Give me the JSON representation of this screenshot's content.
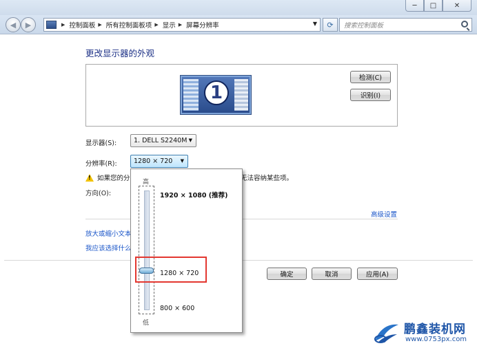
{
  "window": {
    "minimize_glyph": "─",
    "maximize_glyph": "□",
    "close_glyph": "✕"
  },
  "navigation": {
    "breadcrumbs": [
      "控制面板",
      "所有控制面板项",
      "显示",
      "屏幕分辨率"
    ],
    "search_placeholder": "搜索控制面板"
  },
  "main": {
    "title": "更改显示器的外观",
    "monitor_number": "1",
    "detect_button": "检测(C)",
    "identify_button": "识别(I)",
    "display_label": "显示器(S):",
    "display_value": "1. DELL S2240M",
    "resolution_label": "分辨率(R):",
    "resolution_value": "1280 × 720",
    "warning_text_start": "如果您的分",
    "warning_text_end": "无法容纳某些项。",
    "orientation_label": "方向(O):",
    "advanced_link": "高级设置",
    "link_text_size": "放大或缩小文本",
    "link_choose": "我应该选择什么"
  },
  "footer": {
    "ok_button": "确定",
    "cancel_button": "取消",
    "apply_button": "应用(A)"
  },
  "resolution_dropdown": {
    "high_label": "高",
    "low_label": "低",
    "options": [
      "1920 × 1080 (推荐)",
      "1280 × 720",
      "800 × 600"
    ],
    "selected_index": 1,
    "slider_level": 0.67
  },
  "watermark": {
    "title": "鹏鑫装机网",
    "url": "www.0753px.com"
  },
  "colors": {
    "title_blue": "#1e3287",
    "link_blue": "#1c57c9",
    "highlight_red": "#e3362f",
    "watermark_blue": "#1f56a8"
  }
}
